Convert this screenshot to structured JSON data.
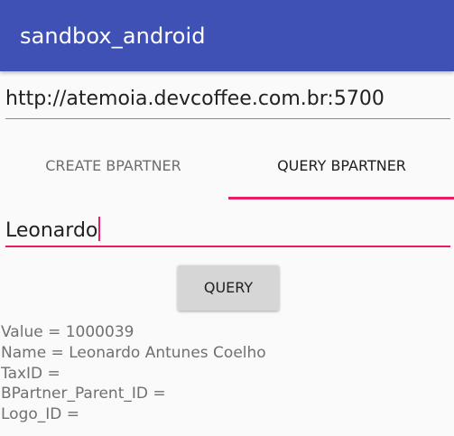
{
  "app_bar": {
    "title": "sandbox_android",
    "color": "#3f51b5"
  },
  "url_field": {
    "value": "http://atemoia.devcoffee.com.br:5700"
  },
  "tabs": [
    {
      "label": "CREATE BPARTNER",
      "selected": false
    },
    {
      "label": "QUERY BPARTNER",
      "selected": true
    }
  ],
  "accent_color": "#e91e63",
  "name_field": {
    "value": "Leonardo"
  },
  "query_button": {
    "label": "QUERY"
  },
  "results": [
    "Value = 1000039",
    "Name = Leonardo Antunes Coelho",
    "TaxID =",
    "BPartner_Parent_ID =",
    "Logo_ID ="
  ]
}
